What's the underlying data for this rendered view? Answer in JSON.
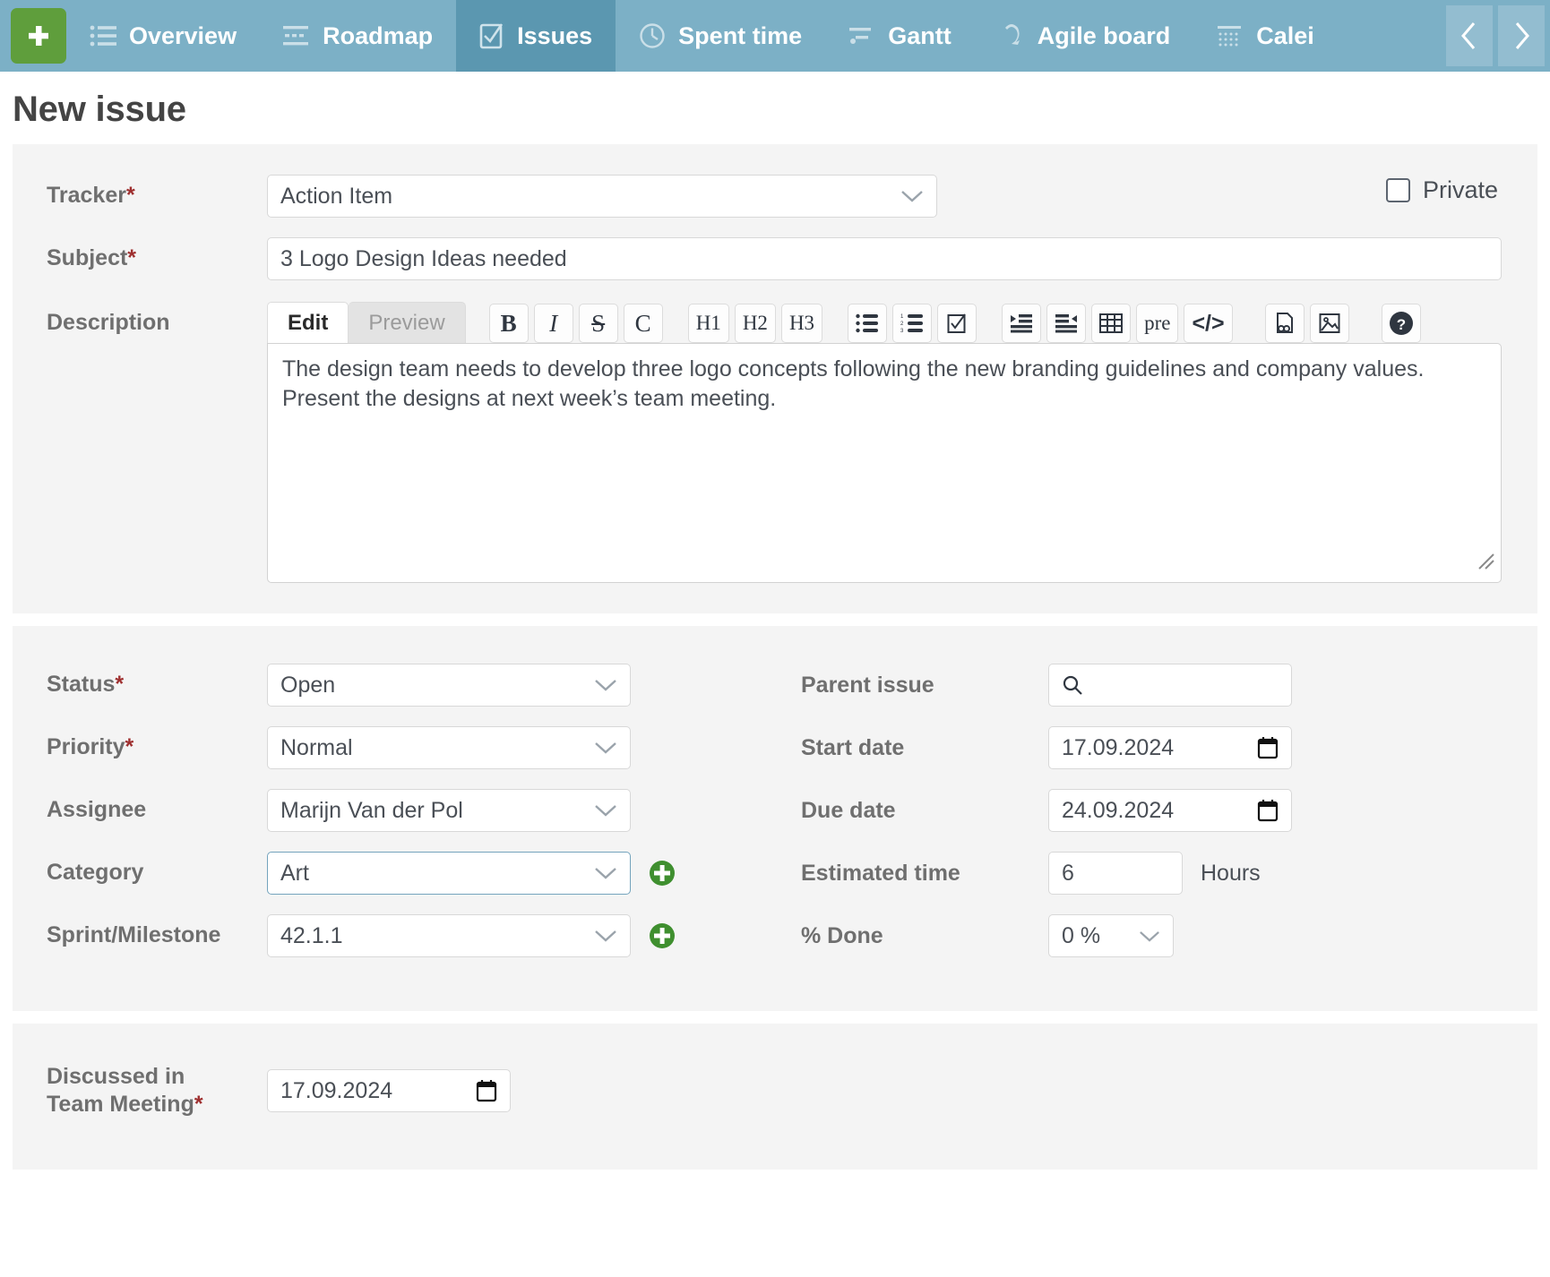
{
  "nav": {
    "add_button": "+",
    "tabs": [
      {
        "label": "Overview",
        "icon": "list-icon",
        "active": false
      },
      {
        "label": "Roadmap",
        "icon": "roadmap-icon",
        "active": false
      },
      {
        "label": "Issues",
        "icon": "checkbox-icon",
        "active": true
      },
      {
        "label": "Spent time",
        "icon": "clock-icon",
        "active": false
      },
      {
        "label": "Gantt",
        "icon": "gantt-icon",
        "active": false
      },
      {
        "label": "Agile board",
        "icon": "agile-icon",
        "active": false
      },
      {
        "label": "Calei",
        "icon": "calendar-grid-icon",
        "active": false
      }
    ],
    "prev_label": "‹",
    "next_label": "›"
  },
  "page": {
    "title": "New issue"
  },
  "form": {
    "tracker": {
      "label": "Tracker",
      "required": "*",
      "value": "Action Item"
    },
    "private": {
      "label": "Private",
      "checked": false
    },
    "subject": {
      "label": "Subject",
      "required": "*",
      "value": "3 Logo Design Ideas needed"
    },
    "description": {
      "label": "Description",
      "tabs": {
        "edit": "Edit",
        "preview": "Preview"
      },
      "toolbar": [
        {
          "name": "bold-icon",
          "label": "B"
        },
        {
          "name": "italic-icon",
          "label": "I"
        },
        {
          "name": "strikethrough-icon",
          "label": "S"
        },
        {
          "name": "code-inline-icon",
          "label": "C"
        },
        {
          "name": "heading-1-icon",
          "label": "H1"
        },
        {
          "name": "heading-2-icon",
          "label": "H2"
        },
        {
          "name": "heading-3-icon",
          "label": "H3"
        },
        {
          "name": "unordered-list-icon",
          "label": ""
        },
        {
          "name": "ordered-list-icon",
          "label": ""
        },
        {
          "name": "checklist-icon",
          "label": ""
        },
        {
          "name": "indent-icon",
          "label": ""
        },
        {
          "name": "outdent-icon",
          "label": ""
        },
        {
          "name": "table-icon",
          "label": ""
        },
        {
          "name": "preformatted-icon",
          "label": "pre"
        },
        {
          "name": "code-block-icon",
          "label": "</>"
        },
        {
          "name": "link-file-icon",
          "label": ""
        },
        {
          "name": "image-icon",
          "label": ""
        },
        {
          "name": "help-icon",
          "label": "?"
        }
      ],
      "value": "The design team needs to develop three logo concepts following the new branding guidelines and company values. Present the designs at next week’s team meeting."
    },
    "status": {
      "label": "Status",
      "required": "*",
      "value": "Open"
    },
    "priority": {
      "label": "Priority",
      "required": "*",
      "value": "Normal"
    },
    "assignee": {
      "label": "Assignee",
      "value": "Marijn Van der Pol"
    },
    "category": {
      "label": "Category",
      "value": "Art",
      "focused": true,
      "add_label": "+"
    },
    "sprint": {
      "label": "Sprint/Milestone",
      "value": "42.1.1",
      "add_label": "+"
    },
    "parent_issue": {
      "label": "Parent issue",
      "value": "",
      "icon": "search-icon"
    },
    "start_date": {
      "label": "Start date",
      "value": "17.09.2024",
      "icon": "calendar-icon"
    },
    "due_date": {
      "label": "Due date",
      "value": "24.09.2024",
      "icon": "calendar-icon"
    },
    "estimated_time": {
      "label": "Estimated time",
      "value": "6",
      "unit": "Hours"
    },
    "percent_done": {
      "label": "% Done",
      "value": "0 %"
    },
    "discussed_meeting": {
      "label_line1": "Discussed in",
      "label_line2": "Team Meeting",
      "required": "*",
      "value": "17.09.2024",
      "icon": "calendar-icon"
    }
  },
  "colors": {
    "nav_bg": "#7cb0c6",
    "nav_active": "#5b97b0",
    "add_green": "#5f9e3c",
    "panel_bg": "#f4f4f4",
    "required_red": "#9e2f2f",
    "focus_blue": "#74a4bd"
  }
}
